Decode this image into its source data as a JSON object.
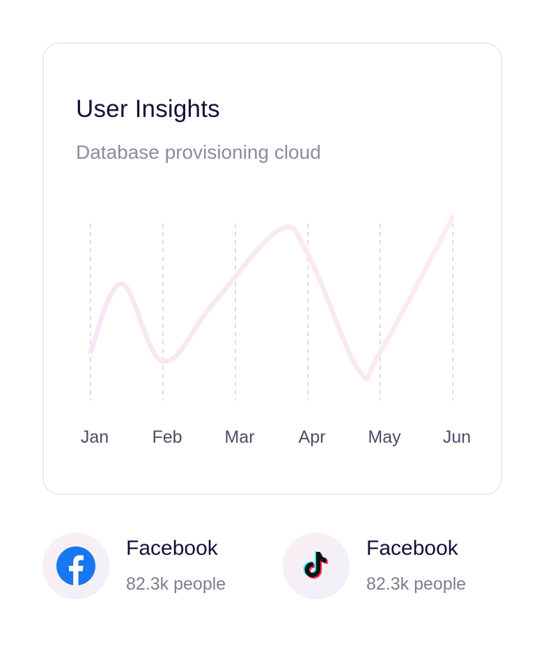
{
  "card": {
    "title": "User Insights",
    "subtitle": "Database provisioning cloud"
  },
  "chart_data": {
    "type": "line",
    "categories": [
      "Jan",
      "Feb",
      "Mar",
      "Apr",
      "May",
      "Jun"
    ],
    "values": [
      15,
      72,
      7,
      56,
      117,
      97,
      0,
      15,
      128
    ],
    "x": [
      0,
      0.43,
      1.0,
      1.7,
      2.6,
      3.0,
      3.7,
      4.0,
      5.0
    ],
    "ylim": [
      0,
      140
    ],
    "grid": "vertical dashed",
    "line_colors": [
      "#f8e6f4",
      "#fbebec"
    ]
  },
  "socials": [
    {
      "name": "Facebook",
      "count": "82.3k people",
      "icon": "facebook-icon"
    },
    {
      "name": "Facebook",
      "count": "82.3k people",
      "icon": "tiktok-icon"
    }
  ],
  "colors": {
    "title": "#0f1238",
    "subtitle": "#8a8c9c",
    "facebook_blue": "#1877f2",
    "tiktok_black": "#111111",
    "tiktok_cyan": "#25f4ee",
    "tiktok_red": "#fe2c55"
  }
}
